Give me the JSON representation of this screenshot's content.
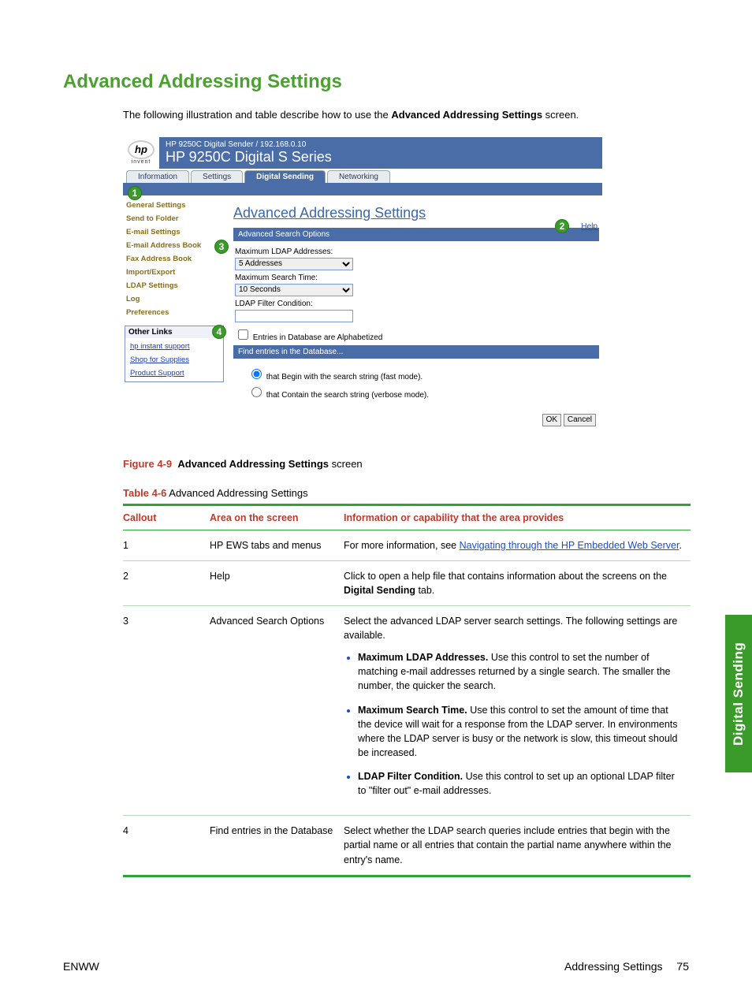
{
  "title": "Advanced Addressing Settings",
  "intro_before": "The following illustration and table describe how to use the ",
  "intro_bold": "Advanced Addressing Settings",
  "intro_after": " screen.",
  "shot": {
    "logo_text": "hp",
    "logo_sub": "invent",
    "header_line1": "HP 9250C Digital Sender / 192.168.0.10",
    "header_line2": "HP 9250C Digital S Series",
    "tabs": [
      "Information",
      "Settings",
      "Digital Sending",
      "Networking"
    ],
    "active_tab_index": 2,
    "nav": [
      "General Settings",
      "Send to Folder",
      "E-mail Settings",
      "E-mail Address Book",
      "Fax Address Book",
      "Import/Export",
      "LDAP Settings",
      "Log",
      "Preferences"
    ],
    "other_links_heading": "Other Links",
    "other_links": [
      "hp instant support",
      "Shop for Supplies",
      "Product Support"
    ],
    "panel_title": "Advanced Addressing Settings",
    "help": "Help",
    "section1": "Advanced Search Options",
    "f_max_addr_label": "Maximum LDAP Addresses:",
    "f_max_addr_value": "5 Addresses",
    "f_max_time_label": "Maximum Search Time:",
    "f_max_time_value": "10 Seconds",
    "f_filter_label": "LDAP Filter Condition:",
    "f_filter_value": "",
    "chk_alpha": "Entries in Database are Alphabetized",
    "section2": "Find entries in the Database...",
    "radio1": "that Begin with the search string (fast mode).",
    "radio2": "that Contain the search string (verbose mode).",
    "btn_ok": "OK",
    "btn_cancel": "Cancel",
    "callouts": {
      "c1": "1",
      "c2": "2",
      "c3": "3",
      "c4": "4"
    }
  },
  "fig": {
    "lead": "Figure 4-9",
    "bold": "Advanced Addressing Settings",
    "after": " screen"
  },
  "tbl_caption": {
    "lead": "Table 4-6",
    "rest": "  Advanced Addressing Settings"
  },
  "table": {
    "head": [
      "Callout",
      "Area on the screen",
      "Information or capability that the area provides"
    ],
    "rows": [
      {
        "c": "1",
        "area": "HP EWS tabs and menus",
        "info_before": "For more information, see ",
        "info_link": "Navigating through the HP Embedded Web Server",
        "info_after": "."
      },
      {
        "c": "2",
        "area": "Help",
        "info_before": "Click to open a help file that contains information about the screens on the ",
        "info_bold": "Digital Sending",
        "info_after": " tab."
      },
      {
        "c": "3",
        "area": "Advanced Search Options",
        "info_before": "Select the advanced LDAP server search settings. The following settings are available.",
        "bullets": [
          {
            "b": "Maximum LDAP Addresses.",
            "t": " Use this control to set the number of matching e-mail addresses returned by a single search. The smaller the number, the quicker the search."
          },
          {
            "b": "Maximum Search Time.",
            "t": " Use this control to set the amount of time that the device will wait for a response from the LDAP server. In environments where the LDAP server is busy or the network is slow, this timeout should be increased."
          },
          {
            "b": "LDAP Filter Condition.",
            "t": " Use this control to set up an optional LDAP filter to \"filter out\" e-mail addresses."
          }
        ]
      },
      {
        "c": "4",
        "area": "Find entries in the Database",
        "info_before": "Select whether the LDAP search queries include entries that begin with the partial name or all entries that contain the partial name anywhere within the entry's name."
      }
    ]
  },
  "side_tab": "Digital Sending",
  "footer": {
    "left": "ENWW",
    "right_label": "Addressing Settings",
    "right_page": "75"
  }
}
